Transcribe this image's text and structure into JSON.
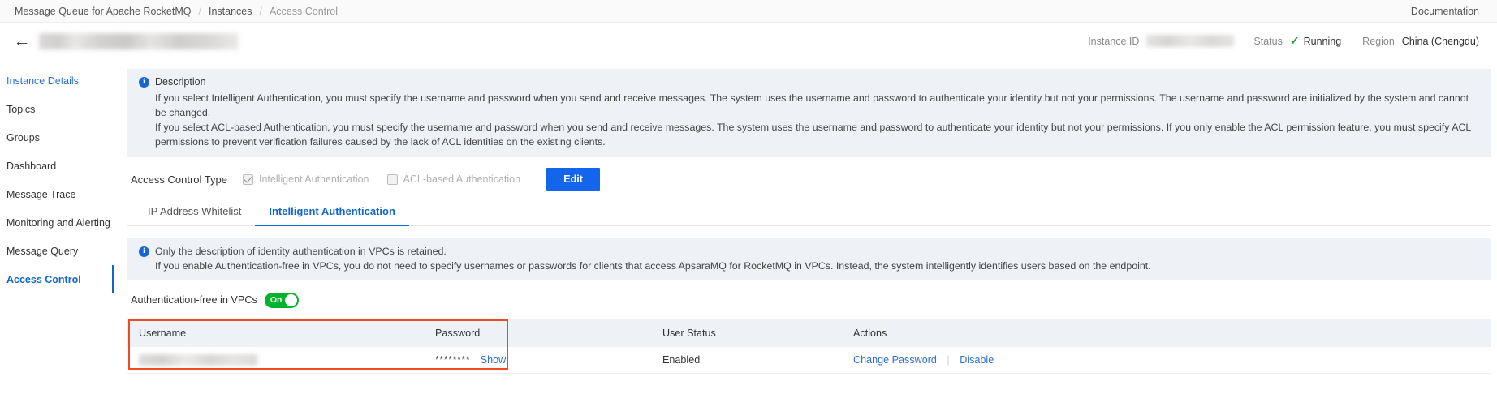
{
  "breadcrumb": {
    "items": [
      {
        "label": "Message Queue for Apache RocketMQ",
        "muted": false
      },
      {
        "label": "Instances",
        "muted": false
      },
      {
        "label": "Access Control",
        "muted": true
      }
    ],
    "separator": "/",
    "documentation_label": "Documentation"
  },
  "title_bar": {
    "back_icon": "arrow-left-icon",
    "instance_name_redacted": true,
    "instance_id_label": "Instance ID",
    "instance_id_redacted": true,
    "status_label": "Status",
    "status_value": "Running",
    "status_icon": "check-icon",
    "status_color": "#22a322",
    "region_label": "Region",
    "region_value": "China (Chengdu)"
  },
  "sidebar": {
    "items": [
      {
        "label": "Instance Details",
        "state": "link"
      },
      {
        "label": "Topics",
        "state": "normal"
      },
      {
        "label": "Groups",
        "state": "normal"
      },
      {
        "label": "Dashboard",
        "state": "normal"
      },
      {
        "label": "Message Trace",
        "state": "normal"
      },
      {
        "label": "Monitoring and Alerting",
        "state": "normal"
      },
      {
        "label": "Message Query",
        "state": "normal"
      },
      {
        "label": "Access Control",
        "state": "active"
      }
    ]
  },
  "description": {
    "icon": "info-icon",
    "title": "Description",
    "paragraph1": "If you select Intelligent Authentication, you must specify the username and password when you send and receive messages. The system uses the username and password to authenticate your identity but not your permissions. The username and password are initialized by the system and cannot be changed.",
    "paragraph2": "If you select ACL-based Authentication, you must specify the username and password when you send and receive messages. The system uses the username and password to authenticate your identity but not your permissions. If you only enable the ACL permission feature, you must specify ACL permissions to prevent verification failures caused by the lack of ACL identities on the existing clients."
  },
  "access_control_type": {
    "label": "Access Control Type",
    "options": [
      {
        "label": "Intelligent Authentication",
        "checked": true,
        "disabled": true
      },
      {
        "label": "ACL-based Authentication",
        "checked": false,
        "disabled": true
      }
    ],
    "edit_label": "Edit",
    "edit_color": "#1366ec"
  },
  "tabs": [
    {
      "label": "IP Address Whitelist",
      "active": false
    },
    {
      "label": "Intelligent Authentication",
      "active": true
    }
  ],
  "vpc_notice": {
    "icon": "info-icon",
    "line1": "Only the description of identity authentication in VPCs is retained.",
    "line2": "If you enable Authentication-free in VPCs, you do not need to specify usernames or passwords for clients that access ApsaraMQ for RocketMQ in VPCs. Instead, the system intelligently identifies users based on the endpoint."
  },
  "auth_free_toggle": {
    "label": "Authentication-free in VPCs",
    "state_text": "On",
    "on": true,
    "color": "#00b32c"
  },
  "table": {
    "columns": [
      "Username",
      "Password",
      "User Status",
      "Actions"
    ],
    "rows": [
      {
        "username_redacted": true,
        "password_mask": "********",
        "password_show_label": "Show",
        "user_status": "Enabled",
        "actions": [
          "Change Password",
          "Disable"
        ],
        "action_separator": "|"
      }
    ],
    "highlight_color": "#f04a23"
  }
}
